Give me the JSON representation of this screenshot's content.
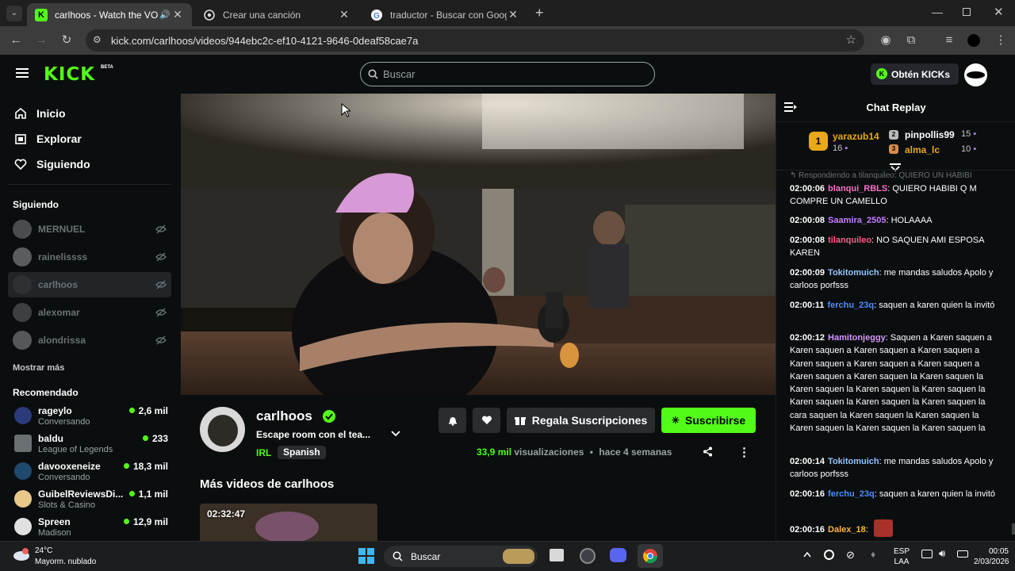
{
  "browser": {
    "tabs": [
      {
        "title": "carlhoos - Watch the VOD o",
        "active": true
      },
      {
        "title": "Crear una canción",
        "active": false
      },
      {
        "title": "traductor - Buscar con Google",
        "active": false
      }
    ],
    "url": "kick.com/carlhoos/videos/944ebc2c-ef10-4121-9646-0deaf58cae7a"
  },
  "header": {
    "logo": "KICK",
    "logo_badge": "BETA",
    "search_placeholder": "Buscar",
    "get_kicks": "Obtén KICKs"
  },
  "sidebar": {
    "nav": [
      {
        "label": "Inicio",
        "icon": "home-icon"
      },
      {
        "label": "Explorar",
        "icon": "explore-icon"
      },
      {
        "label": "Siguiendo",
        "icon": "heart-icon"
      }
    ],
    "following_title": "Siguiendo",
    "following": [
      {
        "name": "MERNUEL"
      },
      {
        "name": "rainelissss"
      },
      {
        "name": "carlhoos"
      },
      {
        "name": "alexomar"
      },
      {
        "name": "alondrissa"
      }
    ],
    "show_more": "Mostrar más",
    "recommended_title": "Recomendado",
    "recommended": [
      {
        "name": "rageylo",
        "category": "Conversando",
        "viewers": "2,6 mil"
      },
      {
        "name": "baldu",
        "category": "League of Legends",
        "viewers": "233"
      },
      {
        "name": "davooxeneize",
        "category": "Conversando",
        "viewers": "18,3 mil"
      },
      {
        "name": "GuibelReviewsDi...",
        "category": "Slots & Casino",
        "viewers": "1,1 mil"
      },
      {
        "name": "Spreen",
        "category": "Madison",
        "viewers": "12,9 mil"
      }
    ]
  },
  "video_info": {
    "channel": "carlhoos",
    "title": "Escape room con el tea...",
    "category": "IRL",
    "language": "Spanish",
    "views_count": "33,9 mil",
    "views_label": "visualizaciones",
    "separator": "•",
    "age": "hace 4 semanas",
    "gift_label": "Regala Suscripciones",
    "subscribe_label": "Suscribirse",
    "more_videos_title": "Más videos de carlhoos",
    "thumb_duration": "02:32:47"
  },
  "chat": {
    "title": "Chat Replay",
    "leaders": [
      {
        "rank": "1",
        "name": "yarazub14",
        "count": "16"
      },
      {
        "rank": "2",
        "name": "pinpollis99",
        "count": "15"
      },
      {
        "rank": "3",
        "name": "alma_lc",
        "count": "10"
      }
    ],
    "reply_note": "Respondiendo a tilanquileo: QUIERO UN HABIBI",
    "messages": [
      {
        "ts": "02:00:06",
        "user": "blanqui_RBLS",
        "color": "#ff6ec7",
        "text": ": QUIERO HABIBI Q M COMPRE UN CAMELLO"
      },
      {
        "ts": "02:00:08",
        "user": "Saamira_2505",
        "color": "#c77dff",
        "text": ": HOLAAAA"
      },
      {
        "ts": "02:00:08",
        "user": "tilanquileo",
        "color": "#ff5c8a",
        "text": ": NO SAQUEN AMI ESPOSA KAREN"
      },
      {
        "ts": "02:00:09",
        "user": "Tokitomuich",
        "color": "#8fc5ff",
        "text": ": me mandas saludos Apolo y carloos porfsss"
      },
      {
        "ts": "02:00:11",
        "user": "ferchu_23q",
        "color": "#4d8dff",
        "text": ": saquen a karen quien la invitó"
      },
      {
        "ts": "02:00:12",
        "user": "Hamitonjeggy",
        "color": "#d694ff",
        "text": ": Saquen a Karen saquen a Karen saquen a Karen saquen a Karen saquen a Karen saquen a Karen saquen a Karen saquen a Karen saquen a Karen saquen la Karen saquen la Karen saquen la Karen saquen la Karen saquen la Karen saquen la Karen saquen la Karen saquen la cara saquen la Karen saquen la Karen saquen la Karen saquen la Karen saquen la Karen saquen la"
      },
      {
        "ts": "02:00:14",
        "user": "Tokitomuich",
        "color": "#8fc5ff",
        "text": ": me mandas saludos Apolo y carloos porfsss"
      },
      {
        "ts": "02:00:16",
        "user": "ferchu_23q",
        "color": "#4d8dff",
        "text": ": saquen a karen quien la invitó"
      },
      {
        "ts": "02:00:16",
        "user": "Dalex_18",
        "color": "#ffb347",
        "text": ":"
      }
    ]
  },
  "taskbar": {
    "weather_temp": "24°C",
    "weather_desc": "Mayorm. nublado",
    "search": "Buscar",
    "lang_top": "ESP",
    "lang_bottom": "LAA",
    "time": "00:05",
    "date": "2/03/2026"
  },
  "colors": {
    "accent": "#53fc18",
    "background": "#0b0e0f"
  }
}
